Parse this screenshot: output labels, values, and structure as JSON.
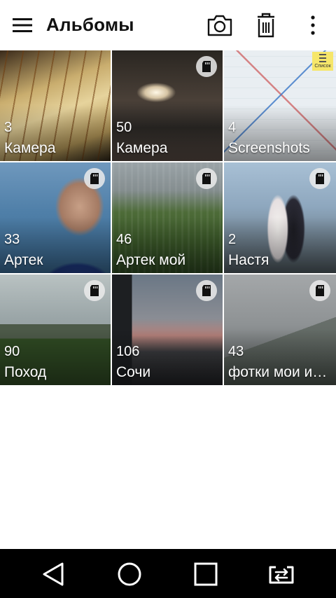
{
  "header": {
    "title": "Альбомы",
    "menu_icon": "hamburger-menu-icon",
    "actions": [
      "camera-icon",
      "trash-icon",
      "more-vert-icon"
    ]
  },
  "albums": [
    {
      "count": "3",
      "name": "Камера",
      "badge": null
    },
    {
      "count": "50",
      "name": "Камера",
      "badge": "sd-card-icon"
    },
    {
      "count": "4",
      "name": "Screenshots",
      "badge": "list-icon",
      "badge_label": "Список"
    },
    {
      "count": "33",
      "name": "Артек",
      "badge": "sd-card-icon"
    },
    {
      "count": "46",
      "name": "Артек мой",
      "badge": "sd-card-icon"
    },
    {
      "count": "2",
      "name": "Настя",
      "badge": "sd-card-icon"
    },
    {
      "count": "90",
      "name": "Поход",
      "badge": "sd-card-icon"
    },
    {
      "count": "106",
      "name": "Сочи",
      "badge": "sd-card-icon"
    },
    {
      "count": "43",
      "name": "фотки мои и…",
      "badge": "sd-card-icon"
    }
  ],
  "navbar": {
    "buttons": [
      "back-icon",
      "home-icon",
      "recents-icon",
      "dual-window-icon"
    ]
  },
  "colors": {
    "appbar_bg": "#ffffff",
    "navbar_bg": "#000000",
    "text_primary": "#111111",
    "overlay_text": "#ffffff"
  }
}
